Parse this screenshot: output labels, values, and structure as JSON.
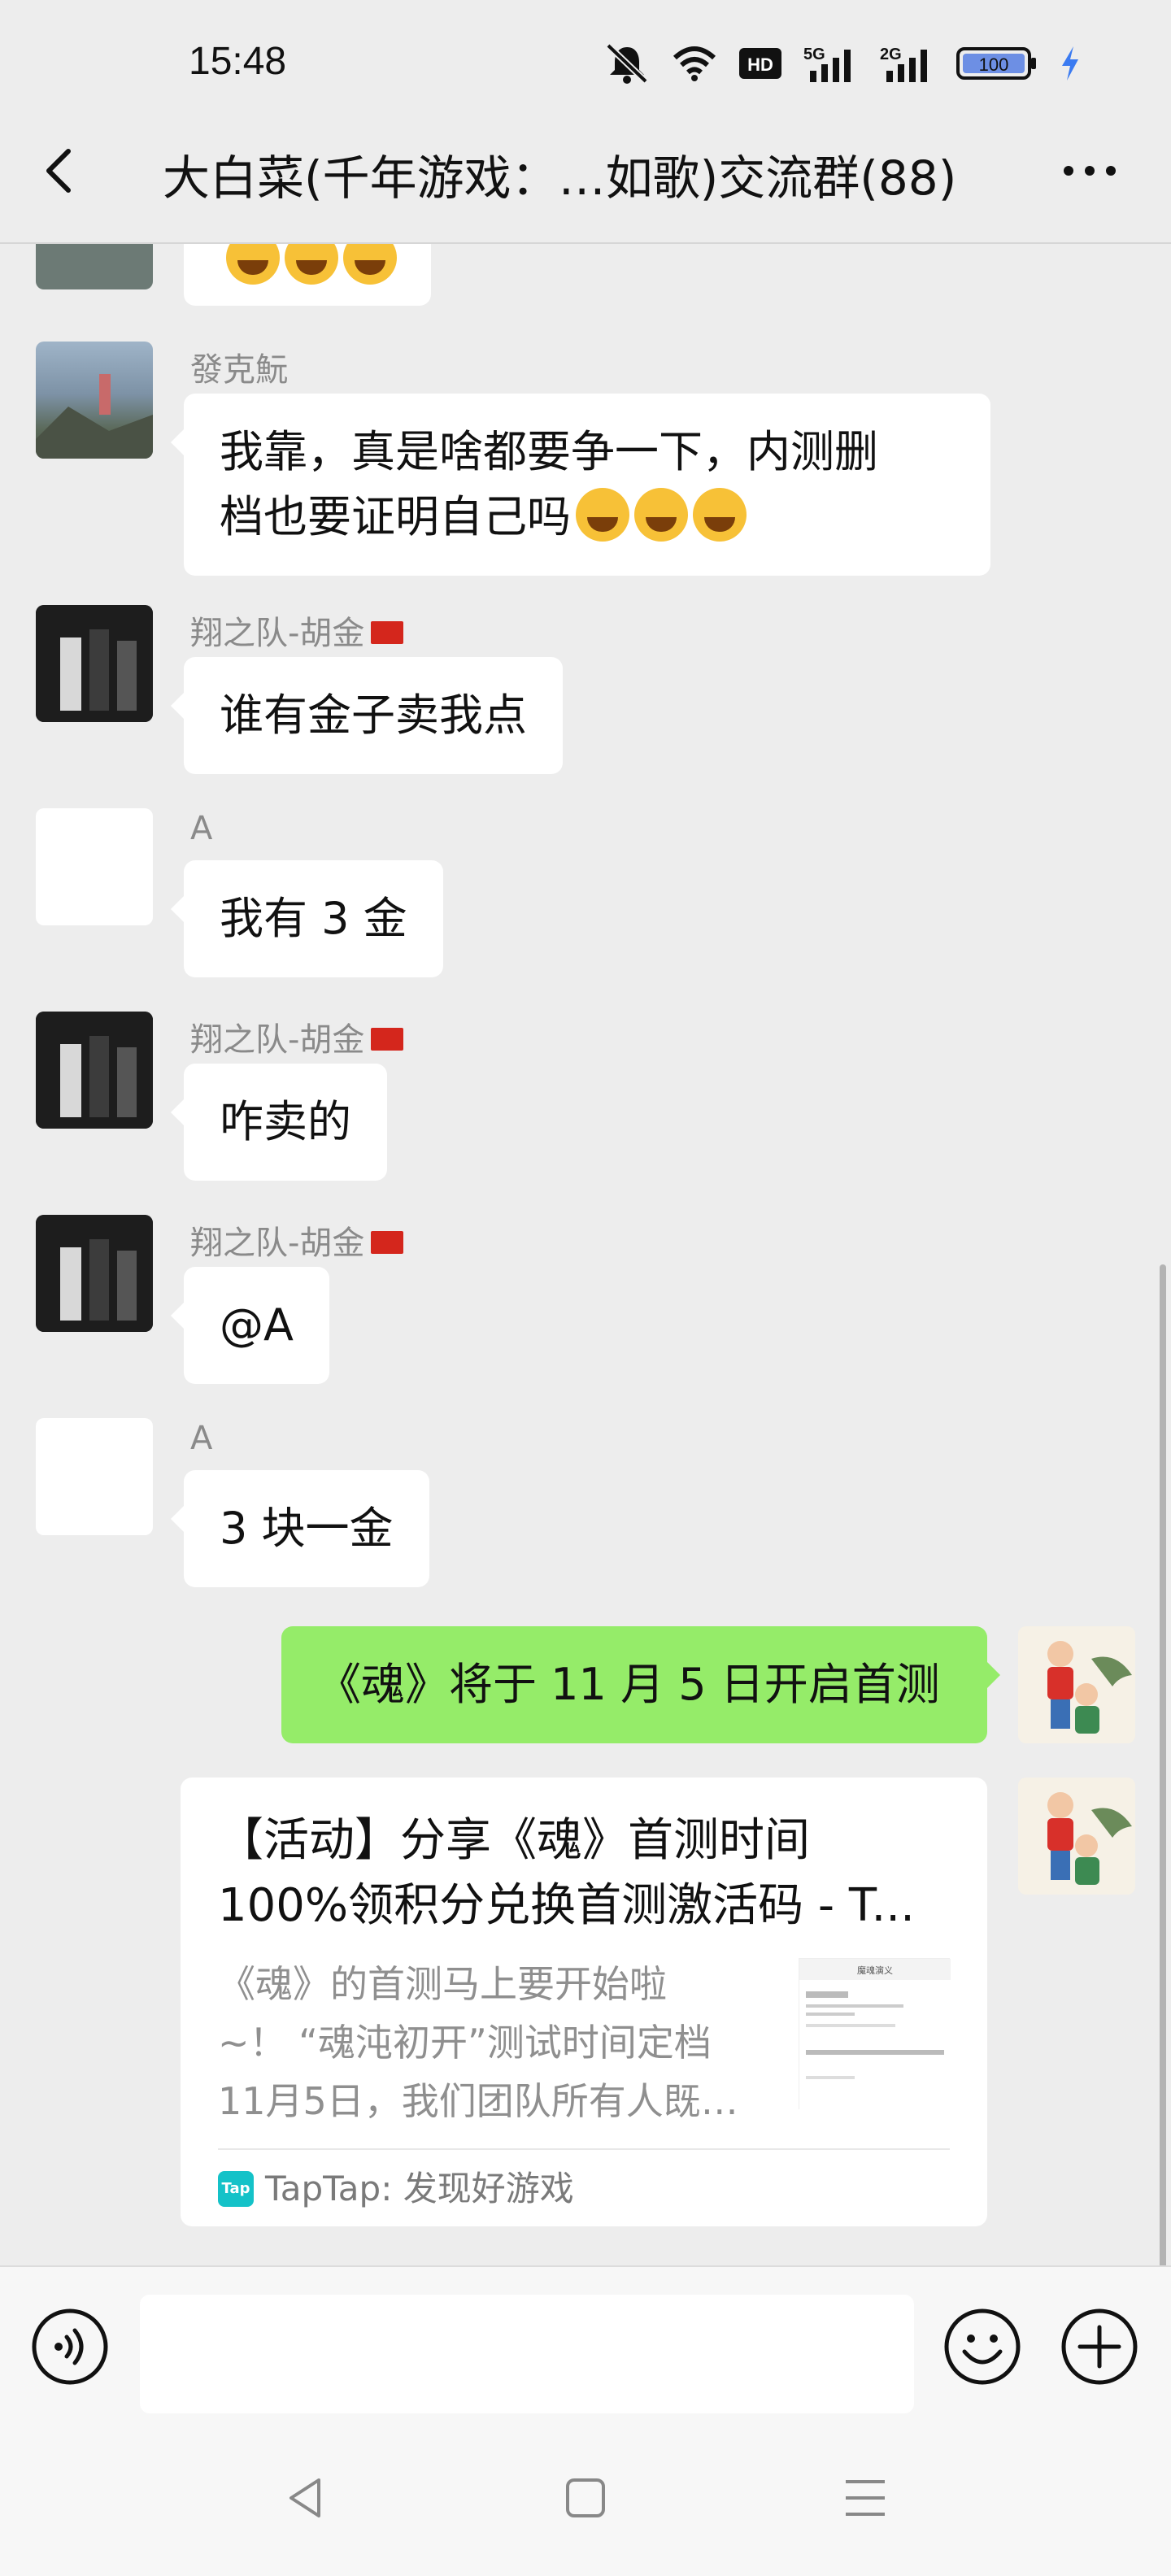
{
  "status_bar": {
    "time": "15:48",
    "icons": [
      "mute-bell-icon",
      "wifi-icon",
      "hd-icon",
      "5g-signal-icon",
      "2g-signal-icon",
      "battery-icon",
      "charging-icon"
    ],
    "network_5g": "5G",
    "network_2g": "2G",
    "hd_label": "HD",
    "battery": "100"
  },
  "nav": {
    "title": "大白菜(千年游戏：…如歌)交流群(88)"
  },
  "messages": [
    {
      "sender": "發克魭",
      "text": "我靠，真是啥都要争一下，内测删",
      "text2": "档也要证明自己吗"
    },
    {
      "sender": "翔之队-胡金",
      "text": "谁有金子卖我点"
    },
    {
      "sender": "A",
      "text": "我有 3 金"
    },
    {
      "sender": "翔之队-胡金",
      "text": "咋卖的"
    },
    {
      "sender": "翔之队-胡金",
      "text": "@A"
    },
    {
      "sender": "A",
      "text": "3 块一金"
    },
    {
      "sender": "",
      "text": "《魂》将于 11 月 5 日开启首测"
    }
  ],
  "link_card": {
    "title": "【活动】分享《魂》首测时间100%领积分兑换首测激活码 - T...",
    "title_line1": "【活动】分享《魂》首测时间",
    "title_line2": "100%领积分兑换首测激活码 - T...",
    "desc_line1": "《魂》的首测马上要开始啦",
    "desc_line2": "~！ “魂沌初开”测试时间定档",
    "desc_line3": "11月5日，我们团队所有人既…",
    "thumb_heading": "魔魂演义",
    "source": "TapTap: 发现好游戏",
    "source_icon_label": "Tap"
  },
  "colors": {
    "background": "#ededed",
    "own_bubble": "#95ec69",
    "other_bubble": "#ffffff",
    "taptap": "#14c2c8"
  }
}
